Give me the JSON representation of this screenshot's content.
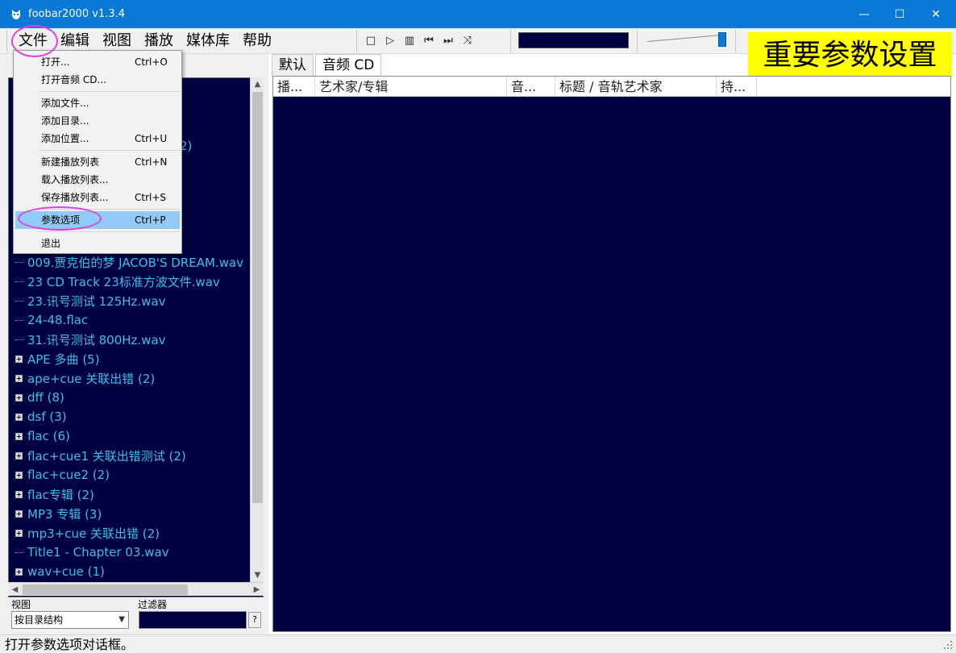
{
  "window": {
    "title": "foobar2000 v1.3.4",
    "minimize_glyph": "—",
    "maximize_glyph": "☐",
    "close_glyph": "✕"
  },
  "menubar": {
    "items": [
      "文件",
      "编辑",
      "视图",
      "播放",
      "媒体库",
      "帮助"
    ]
  },
  "transport": {
    "stop": "□",
    "play": "▷",
    "pause": "▥",
    "prev": "⏮",
    "next": "⏭",
    "random": "⤨"
  },
  "annotation": {
    "text": "重要参数设置",
    "background": "#ffff00"
  },
  "file_menu": {
    "items": [
      {
        "label": "打开...",
        "shortcut": "Ctrl+O"
      },
      {
        "label": "打开音频 CD...",
        "shortcut": ""
      },
      {
        "label": "添加文件...",
        "shortcut": ""
      },
      {
        "label": "添加目录...",
        "shortcut": ""
      },
      {
        "label": "添加位置...",
        "shortcut": "Ctrl+U"
      },
      {
        "label": "新建播放列表",
        "shortcut": "Ctrl+N"
      },
      {
        "label": "载入播放列表...",
        "shortcut": ""
      },
      {
        "label": "保存播放列表...",
        "shortcut": "Ctrl+S"
      },
      {
        "label": "参数选项",
        "shortcut": "Ctrl+P"
      },
      {
        "label": "退出",
        "shortcut": ""
      }
    ],
    "highlighted_item": "参数选项"
  },
  "tree": {
    "partial_visible": "2)",
    "items": [
      {
        "label": "009.贾克伯的梦 JACOB'S DREAM.wav",
        "expandable": false
      },
      {
        "label": "23 CD Track 23标准方波文件.wav",
        "expandable": false
      },
      {
        "label": "23.讯号测试 125Hz.wav",
        "expandable": false
      },
      {
        "label": "24-48.flac",
        "expandable": false
      },
      {
        "label": "31.讯号测试 800Hz.wav",
        "expandable": false
      },
      {
        "label": "APE 多曲 (5)",
        "expandable": true
      },
      {
        "label": "ape+cue 关联出错 (2)",
        "expandable": true
      },
      {
        "label": "dff (8)",
        "expandable": true
      },
      {
        "label": "dsf (3)",
        "expandable": true
      },
      {
        "label": "flac (6)",
        "expandable": true
      },
      {
        "label": "flac+cue1 关联出错测试 (2)",
        "expandable": true
      },
      {
        "label": "flac+cue2 (2)",
        "expandable": true
      },
      {
        "label": "flac专辑 (2)",
        "expandable": true
      },
      {
        "label": "MP3 专辑 (3)",
        "expandable": true
      },
      {
        "label": "mp3+cue 关联出错 (2)",
        "expandable": true
      },
      {
        "label": "Title1 - Chapter 03.wav",
        "expandable": false
      },
      {
        "label": "wav+cue (1)",
        "expandable": true
      }
    ]
  },
  "left_footer": {
    "view_label": "视图",
    "filter_label": "过滤器",
    "view_select_value": "按目录结构",
    "help_button": "?"
  },
  "tabs": [
    {
      "label": "默认",
      "active": false
    },
    {
      "label": "音频 CD",
      "active": true
    }
  ],
  "playlist": {
    "columns": [
      "播...",
      "艺术家/专辑",
      "音...",
      "标题 / 音轨艺术家",
      "持..."
    ]
  },
  "statusbar": {
    "text": "打开参数选项对话框。"
  },
  "colors": {
    "titlebar": "#0a78d7",
    "list_background": "#000040",
    "tree_text": "#3ac1e8",
    "highlight_ring": "#e040e0"
  }
}
